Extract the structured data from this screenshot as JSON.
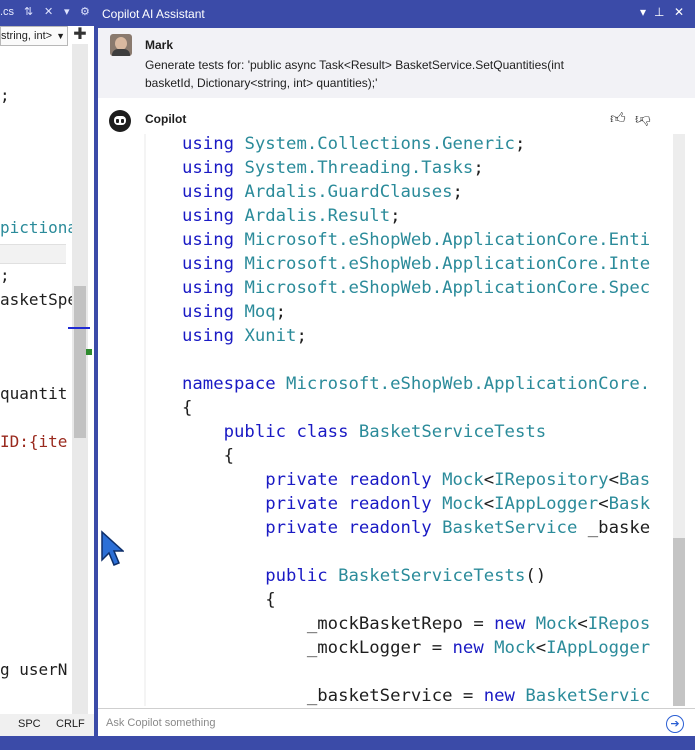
{
  "left_editor": {
    "tab_text": ".cs",
    "dropdown_value": "string, int>",
    "lines": [
      ";",
      "pictiona",
      ";",
      "asketSpe",
      "quantit",
      "ID:{ite",
      "g userN"
    ],
    "status": {
      "spc": "SPC",
      "crlf": "CRLF"
    }
  },
  "panel": {
    "title": "Copilot AI Assistant",
    "user": {
      "name": "Mark",
      "message_line1": "Generate tests for: 'public async Task<Result> BasketService.SetQuantities(int",
      "message_line2": "basketId, Dictionary<string, int> quantities);'"
    },
    "bot": {
      "name": "Copilot"
    },
    "input": {
      "placeholder": "Ask Copilot something"
    }
  },
  "code": [
    [
      [
        "k",
        "using "
      ],
      [
        "t",
        "System.Collections.Generic"
      ],
      [
        "p",
        ";"
      ]
    ],
    [
      [
        "k",
        "using "
      ],
      [
        "t",
        "System.Threading.Tasks"
      ],
      [
        "p",
        ";"
      ]
    ],
    [
      [
        "k",
        "using "
      ],
      [
        "t",
        "Ardalis.GuardClauses"
      ],
      [
        "p",
        ";"
      ]
    ],
    [
      [
        "k",
        "using "
      ],
      [
        "t",
        "Ardalis.Result"
      ],
      [
        "p",
        ";"
      ]
    ],
    [
      [
        "k",
        "using "
      ],
      [
        "t",
        "Microsoft.eShopWeb.ApplicationCore.Enti"
      ]
    ],
    [
      [
        "k",
        "using "
      ],
      [
        "t",
        "Microsoft.eShopWeb.ApplicationCore.Inte"
      ]
    ],
    [
      [
        "k",
        "using "
      ],
      [
        "t",
        "Microsoft.eShopWeb.ApplicationCore.Spec"
      ]
    ],
    [
      [
        "k",
        "using "
      ],
      [
        "t",
        "Moq"
      ],
      [
        "p",
        ";"
      ]
    ],
    [
      [
        "k",
        "using "
      ],
      [
        "t",
        "Xunit"
      ],
      [
        "p",
        ";"
      ]
    ],
    [],
    [
      [
        "k",
        "namespace "
      ],
      [
        "t",
        "Microsoft.eShopWeb.ApplicationCore."
      ]
    ],
    [
      [
        "p",
        "{"
      ]
    ],
    [
      [
        "p",
        "    "
      ],
      [
        "k",
        "public class "
      ],
      [
        "t",
        "BasketServiceTests"
      ]
    ],
    [
      [
        "p",
        "    {"
      ]
    ],
    [
      [
        "p",
        "        "
      ],
      [
        "k",
        "private readonly "
      ],
      [
        "t",
        "Mock"
      ],
      [
        "p",
        "<"
      ],
      [
        "t",
        "IRepository"
      ],
      [
        "p",
        "<"
      ],
      [
        "t",
        "Bas"
      ]
    ],
    [
      [
        "p",
        "        "
      ],
      [
        "k",
        "private readonly "
      ],
      [
        "t",
        "Mock"
      ],
      [
        "p",
        "<"
      ],
      [
        "t",
        "IAppLogger"
      ],
      [
        "p",
        "<"
      ],
      [
        "t",
        "Bask"
      ]
    ],
    [
      [
        "p",
        "        "
      ],
      [
        "k",
        "private readonly "
      ],
      [
        "t",
        "BasketService"
      ],
      [
        "p",
        " _baske"
      ]
    ],
    [],
    [
      [
        "p",
        "        "
      ],
      [
        "k",
        "public "
      ],
      [
        "t",
        "BasketServiceTests"
      ],
      [
        "p",
        "()"
      ]
    ],
    [
      [
        "p",
        "        {"
      ]
    ],
    [
      [
        "p",
        "            _mockBasketRepo = "
      ],
      [
        "k",
        "new "
      ],
      [
        "t",
        "Mock"
      ],
      [
        "p",
        "<"
      ],
      [
        "t",
        "IRepos"
      ]
    ],
    [
      [
        "p",
        "            _mockLogger = "
      ],
      [
        "k",
        "new "
      ],
      [
        "t",
        "Mock"
      ],
      [
        "p",
        "<"
      ],
      [
        "t",
        "IAppLogger"
      ]
    ],
    [],
    [
      [
        "p",
        "            _basketService = "
      ],
      [
        "k",
        "new "
      ],
      [
        "t",
        "BasketServic"
      ]
    ],
    [
      [
        "p",
        "        }"
      ]
    ]
  ]
}
